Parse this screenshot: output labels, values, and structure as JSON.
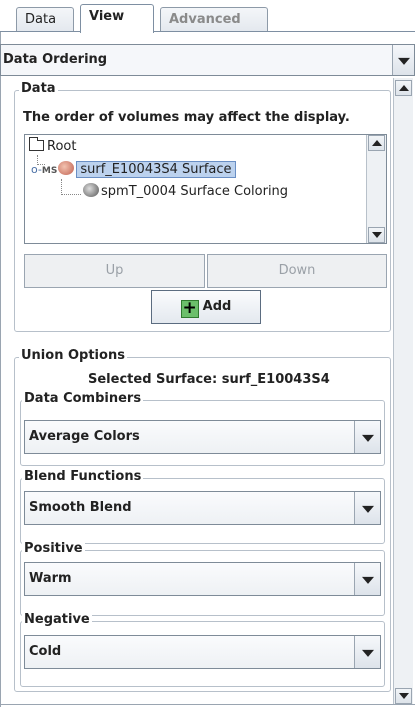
{
  "tabs": [
    {
      "label": "Data",
      "selected": false,
      "enabled": true
    },
    {
      "label": "View",
      "selected": true,
      "enabled": true
    },
    {
      "label": "Advanced",
      "selected": false,
      "enabled": false
    }
  ],
  "top_dropdown": {
    "label": "Data Ordering"
  },
  "data_group": {
    "title": "Data",
    "info": "The order of volumes may affect the display.",
    "tree": {
      "root": "Root",
      "surface_badge": "MS",
      "surface": "surf_E10043S4 Surface",
      "child": "spmT_0004 Surface Coloring"
    },
    "up_label": "Up",
    "down_label": "Down",
    "add_label": "Add"
  },
  "union_group": {
    "title": "Union Options",
    "selected_surface": "Selected Surface: surf_E10043S4",
    "data_combiners": {
      "title": "Data Combiners",
      "value": "Average Colors"
    },
    "blend_functions": {
      "title": "Blend Functions",
      "value": "Smooth Blend"
    },
    "positive": {
      "title": "Positive",
      "value": "Warm"
    },
    "negative": {
      "title": "Negative",
      "value": "Cold"
    }
  },
  "colors": {
    "selection": "#bcd2ee",
    "add_plus": "#6bbf6b"
  }
}
